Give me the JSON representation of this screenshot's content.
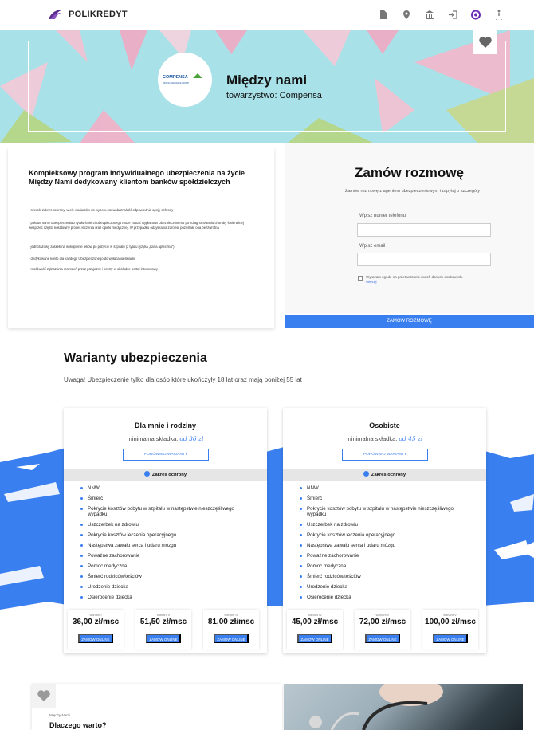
{
  "header": {
    "brand": "POLIKREDYT",
    "icons": [
      "document-icon",
      "location-icon",
      "bank-icon",
      "login-icon",
      "lifebuoy-icon",
      "accessibility-icon"
    ]
  },
  "hero": {
    "title": "Między nami",
    "subtitle": "towarzystwo: Compensa",
    "logo_text": "COMPENSA",
    "logo_sub": "VIENNA INSURANCE GROUP"
  },
  "intro": {
    "heading": "Kompleksowy program indywidualnego ubezpieczenia na życie Między Nami dedykowany klientom banków spółdzielczych",
    "bullets": [
      "- szeroki zakres ochrony, wiele wariantów do wyboru pozwala znaleźć odpowiednią opcję ochrony",
      " - połowa sumy ubezpieczenia z tytułu śmierci Ubezpieczonego może zostać wypłacona Ubezpieczonemu po zdiagnozowaniu choroby śmiertelnej i wesprzeć często kosztowny proces leczenia oraz opieki medycznej. W przypadku odzyskania zdrowia pozostała ona bezzwrotna",
      "-  jednorazowy zasiłek na wykupienie leków po pobycie w szpitalu (z tytułu ryzyka „karta apteczna”)",
      "- dedykowane konto dla każdego Ubezpieczonego do wpłacania składki",
      "- możliwość zgłaszania roszczeń przez przyjazny i prosty w obsłudze portal internetowy"
    ]
  },
  "form": {
    "title": "Zamów rozmowę",
    "subtitle": "Zamów rozmowę z agentem ubezpieczeniowym i zapytaj o szczegóły",
    "phone_label": "Wpisz numer telefonu",
    "email_label": "Wpisz email",
    "consent_text": "Wyrażam zgodę na przetwarzanie moich danych osobowych.",
    "consent_link": "Więcej",
    "submit": "ZAMÓW ROZMOWĘ"
  },
  "variants": {
    "title": "Warianty ubezpieczenia",
    "note": "Uwaga! Ubezpieczenie tylko dla osób które ukończyły 18 lat oraz mają poniżej 55 lat",
    "scope_label": "Zakres ochrony",
    "compare_label": "PORÓWNAJ WARIANTY",
    "order_label": "ZAMÓW ONLINE",
    "min_label": "minimalna składka:",
    "cards": [
      {
        "title": "Dla mnie i rodziny",
        "min_value": "od 36 zł",
        "items": [
          "NNW",
          "Śmierć",
          "Pokrycie kosztów pobytu w szpitalu w następstwie nieszczęśliwego wypadku",
          "Uszczerbek na zdrowiu",
          "Pokrycie kosztów leczenia operacyjnego",
          "Następstwa zawału serca i udaru mózgu",
          "Poważne zachorowanie",
          "Pomoc medyczna",
          "Śmierć rodziców/teściów",
          "Urodzenie dziecka",
          "Osierocenie dziecka"
        ],
        "prices": [
          {
            "label": "wariant I",
            "value": "36,00 zł/msc"
          },
          {
            "label": "wariant II",
            "value": "51,50 zł/msc"
          },
          {
            "label": "wariant III",
            "value": "81,00 zł/msc"
          }
        ]
      },
      {
        "title": "Osobiste",
        "min_value": "od 45 zł",
        "items": [
          "NNW",
          "Śmierć",
          "Pokrycie kosztów pobytu w szpitalu w następstwie nieszczęśliwego wypadku",
          "Uszczerbek na zdrowiu",
          "Pokrycie kosztów leczenia operacyjnego",
          "Następstwa zawału serca i udaru mózgu",
          "Poważne zachorowanie",
          "Pomoc medyczna",
          "Śmierć rodziców/teściów",
          "Urodzenie dziecka",
          "Osierocenie dziecka"
        ],
        "prices": [
          {
            "label": "wariant IV",
            "value": "45,00 zł/msc"
          },
          {
            "label": "wariant V",
            "value": "72,00 zł/msc"
          },
          {
            "label": "wariant VI",
            "value": "100,00 zł/msc"
          }
        ]
      }
    ]
  },
  "why": {
    "small": "Między Nami",
    "title": "Dlaczego warto?"
  },
  "colors": {
    "accent": "#3a7fef",
    "hero_bg": "#a8e1e8"
  }
}
